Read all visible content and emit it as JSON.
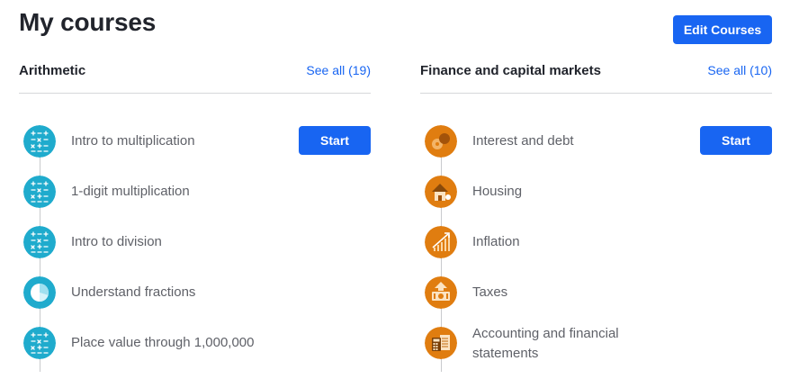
{
  "header": {
    "title": "My courses",
    "edit_label": "Edit Courses"
  },
  "colors": {
    "accent": "#1865f2",
    "math_icon": "#1fabcd",
    "finance_icon": "#e07d10"
  },
  "sections": [
    {
      "title": "Arithmetic",
      "see_all": "See all (19)",
      "items": [
        {
          "label": "Intro to multiplication",
          "icon": "math-symbols-icon",
          "action": "Start"
        },
        {
          "label": "1-digit multiplication",
          "icon": "math-symbols-icon"
        },
        {
          "label": "Intro to division",
          "icon": "math-symbols-icon"
        },
        {
          "label": "Understand fractions",
          "icon": "pie-fraction-icon"
        },
        {
          "label": "Place value through 1,000,000",
          "icon": "math-symbols-icon"
        }
      ]
    },
    {
      "title": "Finance and capital markets",
      "see_all": "See all (10)",
      "items": [
        {
          "label": "Interest and debt",
          "icon": "coins-icon",
          "action": "Start"
        },
        {
          "label": "Housing",
          "icon": "house-icon"
        },
        {
          "label": "Inflation",
          "icon": "rising-chart-icon"
        },
        {
          "label": "Taxes",
          "icon": "money-arrow-icon"
        },
        {
          "label": "Accounting and financial statements",
          "icon": "calculator-document-icon"
        }
      ]
    }
  ]
}
